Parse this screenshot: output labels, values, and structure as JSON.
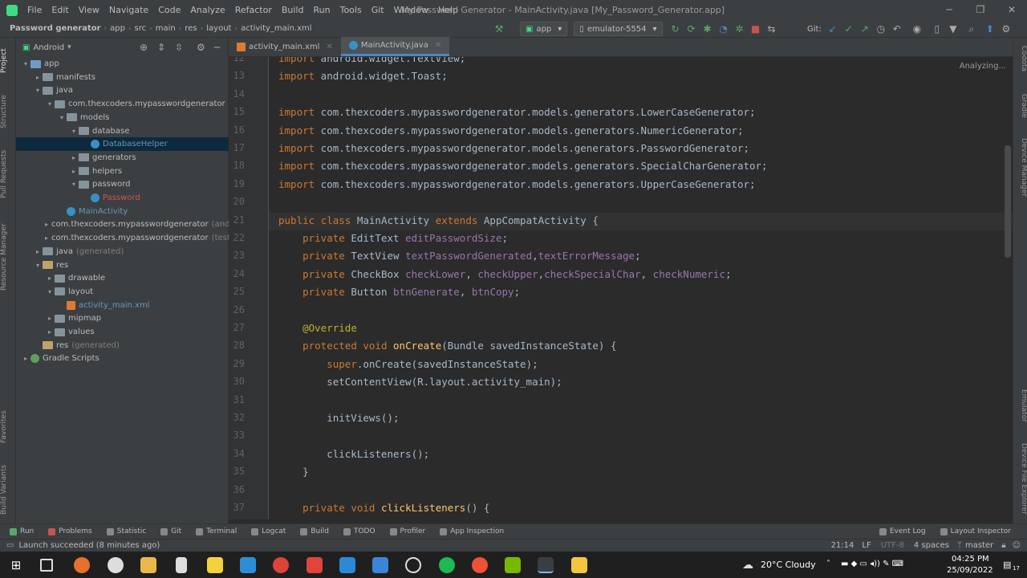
{
  "window": {
    "menu": [
      "File",
      "Edit",
      "View",
      "Navigate",
      "Code",
      "Analyze",
      "Refactor",
      "Build",
      "Run",
      "Tools",
      "Git",
      "Window",
      "Help"
    ],
    "title": "My Password Generator - MainActivity.java [My_Password_Generator.app]"
  },
  "nav": {
    "breadcrumbs": [
      "Password generator",
      "app",
      "src",
      "main",
      "res",
      "layout",
      "activity_main.xml"
    ],
    "run_config": "app",
    "device": "emulator-5554",
    "git_label": "Git:"
  },
  "project_panel": {
    "view_mode": "Android",
    "tree": [
      {
        "label": "app",
        "kind": "folder-blue",
        "arrow": "▾"
      },
      {
        "label": "manifests",
        "kind": "folder",
        "arrow": "▸"
      },
      {
        "label": "java",
        "kind": "folder",
        "arrow": "▾"
      },
      {
        "label": "com.thexcoders.mypasswordgenerator",
        "kind": "folder",
        "arrow": "▾"
      },
      {
        "label": "models",
        "kind": "folder",
        "arrow": "▾"
      },
      {
        "label": "database",
        "kind": "folder",
        "arrow": "▾"
      },
      {
        "label": "DatabaseHelper",
        "kind": "class",
        "arrow": ""
      },
      {
        "label": "generators",
        "kind": "folder",
        "arrow": "▸"
      },
      {
        "label": "helpers",
        "kind": "folder",
        "arrow": "▸"
      },
      {
        "label": "password",
        "kind": "folder",
        "arrow": "▾"
      },
      {
        "label": "Password",
        "kind": "class-red",
        "arrow": ""
      },
      {
        "label": "MainActivity",
        "kind": "class",
        "arrow": ""
      },
      {
        "label": "com.thexcoders.mypasswordgenerator",
        "suffix": "(andr",
        "kind": "folder",
        "arrow": "▸"
      },
      {
        "label": "com.thexcoders.mypasswordgenerator",
        "suffix": "(test)",
        "kind": "folder",
        "arrow": "▸"
      },
      {
        "label": "java",
        "suffix": "(generated)",
        "kind": "folder",
        "arrow": "▸"
      },
      {
        "label": "res",
        "kind": "folder-res",
        "arrow": "▾"
      },
      {
        "label": "drawable",
        "kind": "folder",
        "arrow": "▸"
      },
      {
        "label": "layout",
        "kind": "folder",
        "arrow": "▾"
      },
      {
        "label": "activity_main.xml",
        "kind": "xml",
        "arrow": ""
      },
      {
        "label": "mipmap",
        "kind": "folder",
        "arrow": "▸"
      },
      {
        "label": "values",
        "kind": "folder",
        "arrow": "▸"
      },
      {
        "label": "res",
        "suffix": "(generated)",
        "kind": "folder-res",
        "arrow": ""
      },
      {
        "label": "Gradle Scripts",
        "kind": "gradle",
        "arrow": "▸"
      }
    ]
  },
  "left_strip_tabs": [
    "Project",
    "Structure",
    "Pull Requests",
    "Resource Manager",
    "Favorites",
    "Build Variants"
  ],
  "right_strip_tabs": [
    "Codota",
    "Gradle",
    "Device Manager",
    "Emulator",
    "Device File Explorer"
  ],
  "editor": {
    "tabs": [
      {
        "label": "activity_main.xml",
        "active": false
      },
      {
        "label": "MainActivity.java",
        "active": true
      }
    ],
    "status": "Analyzing...",
    "lines": [
      {
        "n": "12",
        "text": "import android.widget.TextView;"
      },
      {
        "n": "13",
        "text": "import android.widget.Toast;"
      },
      {
        "n": "14",
        "text": ""
      },
      {
        "n": "15",
        "text": "import com.thexcoders.mypasswordgenerator.models.generators.LowerCaseGenerator;"
      },
      {
        "n": "16",
        "text": "import com.thexcoders.mypasswordgenerator.models.generators.NumericGenerator;"
      },
      {
        "n": "17",
        "text": "import com.thexcoders.mypasswordgenerator.models.generators.PasswordGenerator;"
      },
      {
        "n": "18",
        "text": "import com.thexcoders.mypasswordgenerator.models.generators.SpecialCharGenerator;"
      },
      {
        "n": "19",
        "text": "import com.thexcoders.mypasswordgenerator.models.generators.UpperCaseGenerator;"
      },
      {
        "n": "20",
        "text": ""
      },
      {
        "n": "21",
        "text": "public class MainActivity extends AppCompatActivity {"
      },
      {
        "n": "22",
        "text": "    private EditText editPasswordSize;"
      },
      {
        "n": "23",
        "text": "    private TextView textPasswordGenerated,textErrorMessage;"
      },
      {
        "n": "24",
        "text": "    private CheckBox checkLower, checkUpper,checkSpecialChar, checkNumeric;"
      },
      {
        "n": "25",
        "text": "    private Button btnGenerate, btnCopy;"
      },
      {
        "n": "26",
        "text": ""
      },
      {
        "n": "27",
        "text": "    @Override"
      },
      {
        "n": "28",
        "text": "    protected void onCreate(Bundle savedInstanceState) {"
      },
      {
        "n": "29",
        "text": "        super.onCreate(savedInstanceState);"
      },
      {
        "n": "30",
        "text": "        setContentView(R.layout.activity_main);"
      },
      {
        "n": "31",
        "text": ""
      },
      {
        "n": "32",
        "text": "        initViews();"
      },
      {
        "n": "33",
        "text": ""
      },
      {
        "n": "34",
        "text": "        clickListeners();"
      },
      {
        "n": "35",
        "text": "    }"
      },
      {
        "n": "36",
        "text": ""
      },
      {
        "n": "37",
        "text": "    private void clickListeners() {"
      }
    ]
  },
  "tool_tabs": [
    "Run",
    "Problems",
    "Statistic",
    "Git",
    "Terminal",
    "Logcat",
    "Build",
    "TODO",
    "Profiler",
    "App Inspection"
  ],
  "tool_tabs_right": [
    "Event Log",
    "Layout Inspector"
  ],
  "statusbar": {
    "message": "Launch succeeded (8 minutes ago)",
    "position": "21:14",
    "line_sep": "LF",
    "encoding": "UTF-8",
    "indent": "4 spaces",
    "branch": "master"
  },
  "taskbar": {
    "weather": "20°C  Cloudy",
    "time": "04:25 PM",
    "date": "25/09/2022",
    "notifications": "17"
  },
  "colors": {
    "keyword": "#cc7832",
    "field": "#9876aa",
    "annotation": "#bbb529",
    "method": "#ffc66d",
    "text": "#a9b7c6",
    "selection": "#0d293e"
  }
}
